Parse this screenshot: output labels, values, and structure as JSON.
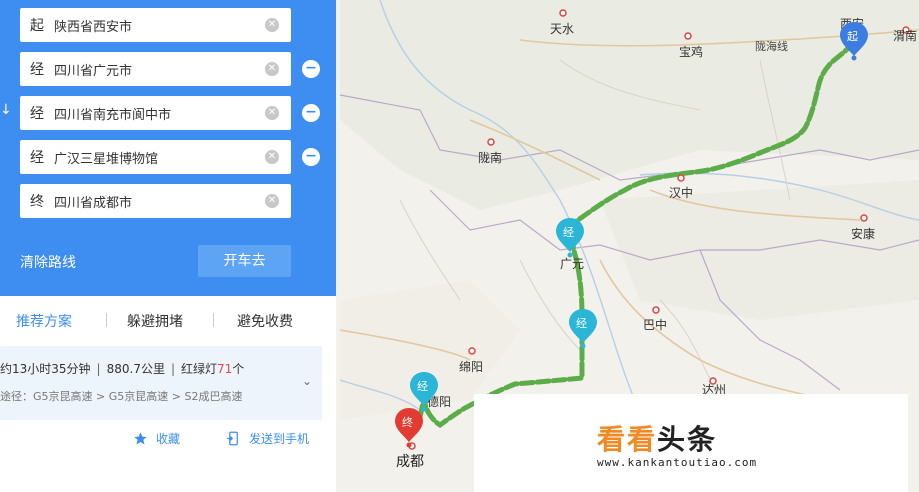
{
  "route_panel": {
    "stops": [
      {
        "tag": "起",
        "name": "陕西省西安市"
      },
      {
        "tag": "经",
        "name": "四川省广元市"
      },
      {
        "tag": "经",
        "name": "四川省南充市阆中市"
      },
      {
        "tag": "经",
        "name": "广汉三星堆博物馆"
      },
      {
        "tag": "终",
        "name": "四川省成都市"
      }
    ],
    "clear_glyph": "⊗",
    "remove_glyph": "−",
    "swap_glyph": "↓",
    "clear_route_label": "清除路线",
    "drive_button_label": "开车去",
    "accent_color": "#3d8ef0"
  },
  "options_tabs": [
    {
      "label": "推荐方案",
      "active": true
    },
    {
      "label": "躲避拥堵",
      "active": false
    },
    {
      "label": "避免收费",
      "active": false
    }
  ],
  "route_result": {
    "duration": "约13小时35分钟",
    "distance": "880.7公里",
    "traffic_lights_prefix": "红绿灯",
    "traffic_lights_count": "71",
    "traffic_lights_suffix": "个",
    "via": "途径：G5京昆高速 > G5京昆高速 > S2成巴高速",
    "expand_glyph": "⌄"
  },
  "actions": {
    "favorite_label": "收藏",
    "send_label": "发送到手机"
  },
  "map": {
    "cities": [
      {
        "id": "tianshui",
        "name": "天水"
      },
      {
        "id": "baoji",
        "name": "宝鸡"
      },
      {
        "id": "xian",
        "name": "西安"
      },
      {
        "id": "weinan",
        "name": "渭南"
      },
      {
        "id": "longnan",
        "name": "陇南"
      },
      {
        "id": "hanzhong",
        "name": "汉中"
      },
      {
        "id": "ankang",
        "name": "安康"
      },
      {
        "id": "guangyuan",
        "name": "广元"
      },
      {
        "id": "bazhong",
        "name": "巴中"
      },
      {
        "id": "mianyang",
        "name": "绵阳"
      },
      {
        "id": "deyang",
        "name": "德阳"
      },
      {
        "id": "chengdu",
        "name": "成都"
      },
      {
        "id": "dazhou",
        "name": "达州"
      }
    ],
    "railway_label": "陇海线",
    "markers": {
      "start": "起",
      "via": "经",
      "end": "终"
    },
    "route_color": "#5cac4a"
  },
  "watermark": {
    "title_orange": "看看",
    "title_dark": "头条",
    "url": "www.kankantoutiao.com"
  }
}
